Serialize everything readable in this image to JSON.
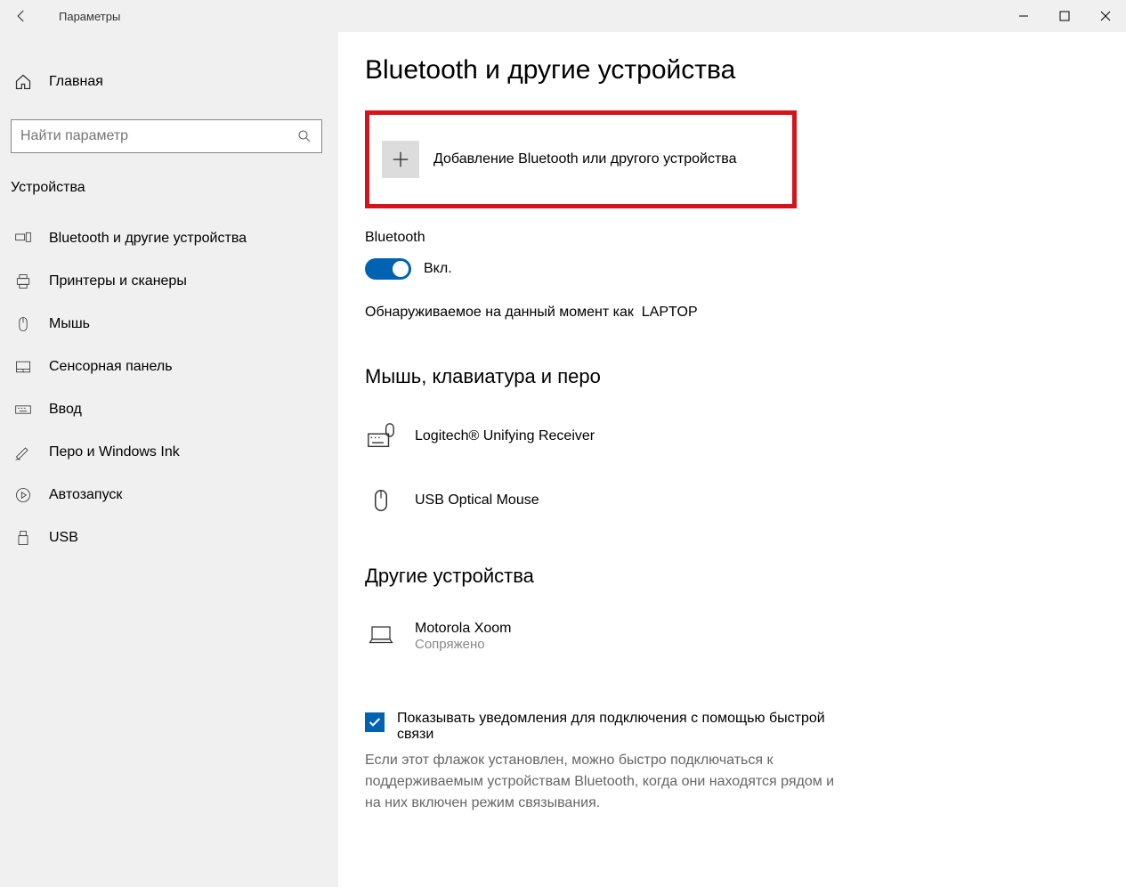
{
  "window": {
    "title": "Параметры"
  },
  "sidebar": {
    "home": "Главная",
    "search_placeholder": "Найти параметр",
    "category": "Устройства",
    "items": [
      {
        "label": "Bluetooth и другие устройства"
      },
      {
        "label": "Принтеры и сканеры"
      },
      {
        "label": "Мышь"
      },
      {
        "label": "Сенсорная панель"
      },
      {
        "label": "Ввод"
      },
      {
        "label": "Перо и Windows Ink"
      },
      {
        "label": "Автозапуск"
      },
      {
        "label": "USB"
      }
    ]
  },
  "main": {
    "title": "Bluetooth и другие устройства",
    "add_device": "Добавление Bluetooth или другого устройства",
    "bluetooth_label": "Bluetooth",
    "toggle_state": "Вкл.",
    "discoverable_prefix": "Обнаруживаемое на данный момент как",
    "discoverable_name": "LAPTOP",
    "section_input_title": "Мышь, клавиатура и перо",
    "devices_input": [
      {
        "name": "Logitech® Unifying Receiver"
      },
      {
        "name": "USB Optical Mouse"
      }
    ],
    "section_other_title": "Другие устройства",
    "devices_other": [
      {
        "name": "Motorola Xoom",
        "status": "Сопряжено"
      }
    ],
    "checkbox_label": "Показывать уведомления для подключения с помощью быстрой связи",
    "checkbox_help": "Если этот флажок установлен, можно быстро подключаться к поддерживаемым устройствам Bluetooth, когда они находятся рядом и на них включен режим связывания."
  }
}
